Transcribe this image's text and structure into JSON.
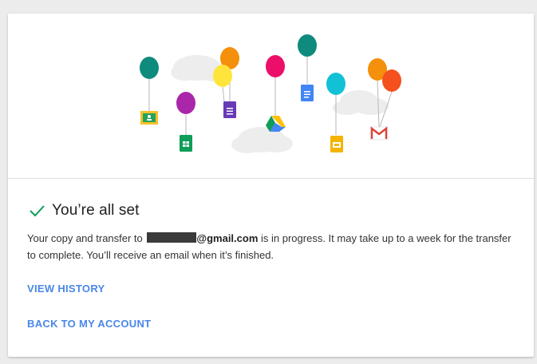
{
  "status": {
    "title": "You’re all set",
    "message_pre": "Your copy and transfer to",
    "email_domain": "@gmail.com",
    "message_post": "is in progress. It may take up to a week for the transfer to complete. You’ll receive an email when it’s finished."
  },
  "actions": {
    "view_history": "VIEW HISTORY",
    "back_to_account": "BACK TO MY ACCOUNT"
  },
  "colors": {
    "accent_link": "#4a86e8",
    "check": "#0f9d58"
  },
  "illustration": {
    "icons": [
      "classroom-icon",
      "sheets-icon",
      "forms-icon",
      "drive-icon",
      "docs-icon",
      "slides-icon",
      "gmail-icon"
    ]
  }
}
